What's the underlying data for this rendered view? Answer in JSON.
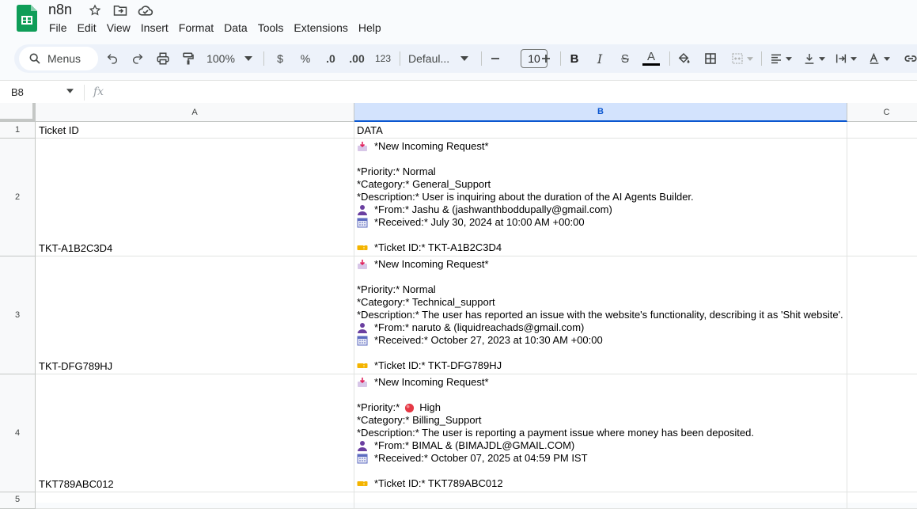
{
  "app": {
    "doc_title": "n8n",
    "menu": [
      "File",
      "Edit",
      "View",
      "Insert",
      "Format",
      "Data",
      "Tools",
      "Extensions",
      "Help"
    ]
  },
  "toolbar": {
    "search_label": "Menus",
    "zoom": "100%",
    "currency": "$",
    "percent": "%",
    "dec_decrease": ".0",
    "dec_increase": ".00",
    "number_format": "123",
    "font": "Defaul...",
    "font_size": "10",
    "bold": "B",
    "italic": "I",
    "strike": "S",
    "text_color": "A"
  },
  "formula_bar": {
    "cell_ref": "B8",
    "fx": "fx",
    "value": ""
  },
  "columns": [
    "A",
    "B",
    "C"
  ],
  "rows": [
    {
      "num": "1",
      "a": "Ticket ID",
      "b_header": "DATA"
    },
    {
      "num": "2",
      "a": "TKT-A1B2C3D4",
      "b": {
        "title": "*New Incoming Request*",
        "priority": "*Priority:* Normal",
        "category": "*Category:* General_Support",
        "description": "*Description:* User is inquiring about the duration of the AI Agents Builder.",
        "from": "*From:* Jashu & (jashwanthboddupally@gmail.com)",
        "received": "*Received:* July 30, 2024 at 10:00 AM +00:00",
        "ticket": "*Ticket ID:* TKT-A1B2C3D4"
      }
    },
    {
      "num": "3",
      "a": "TKT-DFG789HJ",
      "b": {
        "title": "*New Incoming Request*",
        "priority": "*Priority:* Normal",
        "category": "*Category:* Technical_support",
        "description": "*Description:* The user has reported an issue with the website's functionality, describing it as 'Shit website'.",
        "from": "*From:* naruto & (liquidreachads@gmail.com)",
        "received": "*Received:* October 27, 2023 at 10:30 AM +00:00",
        "ticket": "*Ticket ID:* TKT-DFG789HJ"
      }
    },
    {
      "num": "4",
      "a": "TKT789ABC012",
      "b": {
        "title": "*New Incoming Request*",
        "priority_prefix": "*Priority:*",
        "priority_value": "High",
        "category": "*Category:* Billing_Support",
        "description": "*Description:* The user is reporting a payment issue where money has been deposited.",
        "from": "*From:* BIMAL & (BIMAJDL@GMAIL.COM)",
        "received": "*Received:* October 07, 2025 at 04:59 PM IST",
        "ticket": "*Ticket ID:* TKT789ABC012"
      }
    },
    {
      "num": "5"
    }
  ],
  "colors": {
    "accent": "#0b57d0",
    "selected_col": "#d3e3fd",
    "sheets_green": "#0f9d58"
  },
  "icons": [
    "inbox-tray-icon",
    "person-icon",
    "calendar-icon",
    "ticket-icon",
    "red-circle-icon"
  ]
}
